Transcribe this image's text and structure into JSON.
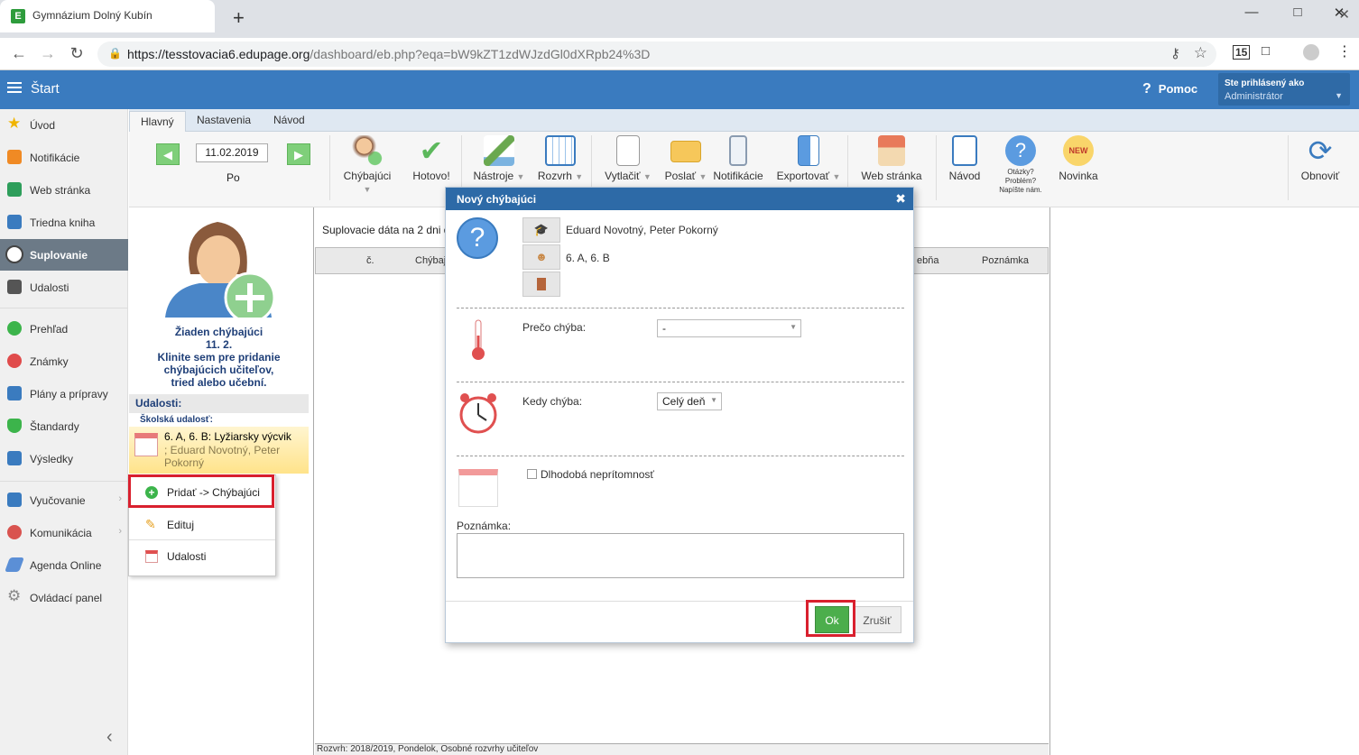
{
  "browser": {
    "tab_title": "Gymnázium Dolný Kubín",
    "favicon_letter": "E",
    "new_tab_icon": "+",
    "close_tab_icon": "✕",
    "url_host": "https://tesstovacia6.edupage.org",
    "url_path": "/dashboard/eb.php?eqa=bW9kZT1zdWJzdGl0dXRpb24%3D",
    "ext_badge": "15"
  },
  "header": {
    "start_label": "Štart",
    "help_label": "Pomoc",
    "help_icon": "?",
    "user_line1": "Ste prihlásený ako",
    "user_line2": "Administrátor"
  },
  "sidebar": {
    "items": [
      {
        "label": "Úvod",
        "color": "#f0b400"
      },
      {
        "label": "Notifikácie",
        "color": "#f08a24"
      },
      {
        "label": "Web stránka",
        "color": "#2e9e5b"
      },
      {
        "label": "Triedna kniha",
        "color": "#3a7bbf"
      },
      {
        "label": "Suplovanie",
        "color": "#ffffff"
      },
      {
        "label": "Udalosti",
        "color": "#555555"
      },
      {
        "label": "Prehľad",
        "color": "#3cb44b"
      },
      {
        "label": "Známky",
        "color": "#e04b4b"
      },
      {
        "label": "Plány a prípravy",
        "color": "#3a7bbf"
      },
      {
        "label": "Štandardy",
        "color": "#3cb44b"
      },
      {
        "label": "Výsledky",
        "color": "#3a7bbf"
      },
      {
        "label": "Vyučovanie",
        "color": "#3a7bbf"
      },
      {
        "label": "Komunikácia",
        "color": "#d9534f"
      },
      {
        "label": "Agenda Online",
        "color": "#5b8fd6"
      },
      {
        "label": "Ovládací panel",
        "color": "#888888"
      }
    ]
  },
  "ribbon": {
    "tabs": [
      "Hlavný",
      "Nastavenia",
      "Návod"
    ],
    "date": "11.02.2019",
    "day": "Po",
    "buttons": {
      "chybajuci": "Chýbajúci",
      "hotovo": "Hotovo!",
      "nastroje": "Nástroje",
      "rozvrh": "Rozvrh",
      "vytlacit": "Vytlačiť",
      "poslat": "Poslať",
      "notifikacie": "Notifikácie",
      "exportovat": "Exportovať",
      "web": "Web stránka",
      "navod": "Návod",
      "otazky": "Otázky? Problém? Napíšte nám.",
      "novinka": "Novinka",
      "obnovit": "Obnoviť",
      "new_badge": "NEW"
    }
  },
  "left_panel": {
    "line1": "Žiaden chýbajúci",
    "line2": "11. 2.",
    "line3": "Klinite sem pre pridanie chýbajúcich učiteľov, tried alebo učební.",
    "events_header": "Udalosti:",
    "school_event_label": "Školská udalosť:",
    "event_title": "6. A, 6. B: Lyžiarsky výcvik",
    "event_people": "; Eduard Novotný, Peter Pokorný"
  },
  "context_menu": {
    "items": [
      "Pridať -> Chýbajúci",
      "Edituj",
      "Udalosti"
    ]
  },
  "main": {
    "info": "Suplovacie dáta na 2 dni d",
    "columns": [
      "č.",
      "Chýbaj",
      "ebňa",
      "Poznámka"
    ],
    "status": "Rozvrh: 2018/2019, Pondelok, Osobné rozvrhy učiteľov"
  },
  "dialog": {
    "title": "Nový chýbajúci",
    "close_icon": "✖",
    "teachers": "Eduard Novotný, Peter Pokorný",
    "classes": "6. A, 6. B",
    "why_label": "Prečo chýba:",
    "why_value": "-",
    "when_label": "Kedy chýba:",
    "when_value": "Celý deň",
    "long_absence_label": "Dlhodobá neprítomnosť",
    "note_label": "Poznámka:",
    "ok_label": "Ok",
    "cancel_label": "Zrušiť"
  }
}
